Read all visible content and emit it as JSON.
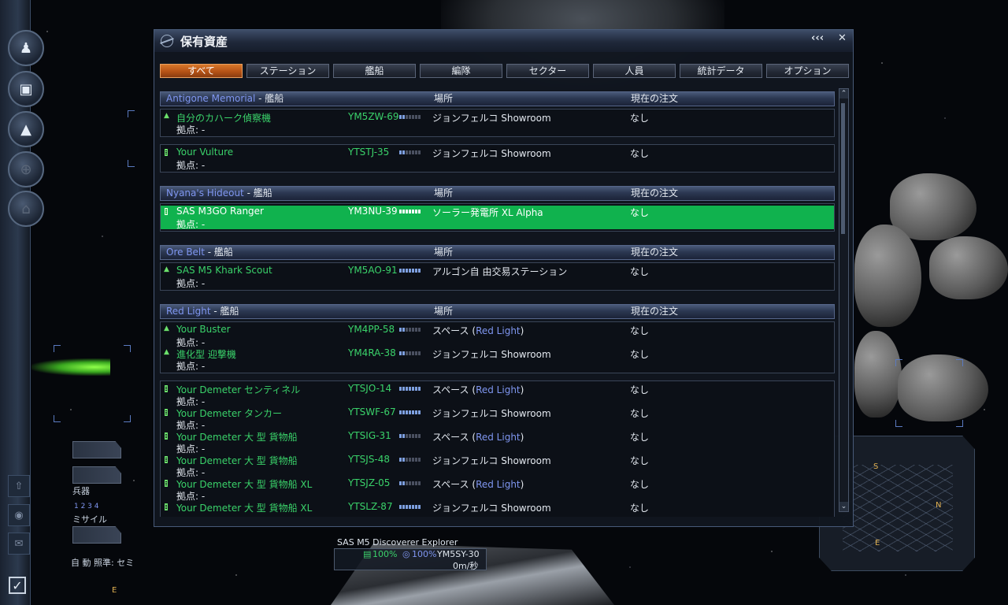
{
  "window": {
    "title": "保有資産",
    "collapse_label": "‹‹‹",
    "close_label": "✕"
  },
  "tabs": [
    {
      "label": "すべて",
      "active": true
    },
    {
      "label": "ステーション"
    },
    {
      "label": "艦船"
    },
    {
      "label": "編隊"
    },
    {
      "label": "セクター"
    },
    {
      "label": "人員"
    },
    {
      "label": "統計データ"
    },
    {
      "label": "オプション"
    }
  ],
  "columns": {
    "location": "場所",
    "order": "現在の注文"
  },
  "groups": [
    {
      "sector": "Antigone Memorial",
      "suffix": " - 艦船"
    },
    {
      "sector": "Nyana's Hideout",
      "suffix": " - 艦船"
    },
    {
      "sector": "Ore Belt",
      "suffix": " - 艦船"
    },
    {
      "sector": "Red Light",
      "suffix": " - 艦船"
    }
  ],
  "ships": [
    {
      "name": "自分のカハーク偵察機",
      "home": "拠点: -",
      "id": "YM5ZW-69",
      "location": "ジョンフェルコ Showroom",
      "order": "なし"
    },
    {
      "name": "Your Vulture",
      "home": "拠点: -",
      "id": "YTSTJ-35",
      "location": "ジョンフェルコ Showroom",
      "order": "なし"
    },
    {
      "name": "SAS M3GO Ranger",
      "home": "拠点: -",
      "id": "YM3NU-39",
      "location": "ソーラー発電所 XL Alpha",
      "order": "なし"
    },
    {
      "name": "SAS M5 Khark Scout",
      "home": "拠点: -",
      "id": "YM5AO-91",
      "location": "アルゴン自 由交易ステーション",
      "order": "なし"
    },
    {
      "name": "Your Buster",
      "home": "拠点: -",
      "id": "YM4PP-58",
      "location_prefix": "スペース (",
      "location_sector": "Red Light",
      "location_suffix": ")",
      "order": "なし"
    },
    {
      "name": "進化型 迎撃機",
      "home": "拠点: -",
      "id": "YM4RA-38",
      "location": "ジョンフェルコ Showroom",
      "order": "なし"
    },
    {
      "name": "Your Demeter センティネル",
      "home": "拠点: -",
      "id": "YTSJO-14",
      "location_prefix": "スペース (",
      "location_sector": "Red Light",
      "location_suffix": ")",
      "order": "なし"
    },
    {
      "name": "Your Demeter タンカー",
      "home": "拠点: -",
      "id": "YTSWF-67",
      "location": "ジョンフェルコ Showroom",
      "order": "なし"
    },
    {
      "name": "Your Demeter 大 型 貨物船",
      "home": "拠点: -",
      "id": "YTSIG-31",
      "location_prefix": "スペース (",
      "location_sector": "Red Light",
      "location_suffix": ")",
      "order": "なし"
    },
    {
      "name": "Your Demeter 大 型 貨物船",
      "home": "拠点: -",
      "id": "YTSJS-48",
      "location": "ジョンフェルコ Showroom",
      "order": "なし"
    },
    {
      "name": "Your Demeter 大 型 貨物船 XL",
      "home": "拠点: -",
      "id": "YTSJZ-05",
      "location_prefix": "スペース (",
      "location_sector": "Red Light",
      "location_suffix": ")",
      "order": "なし"
    },
    {
      "name": "Your Demeter 大 型 貨物船 XL",
      "home": "拠点: -",
      "id": "YTSLZ-87",
      "location": "ジョンフェルコ Showroom",
      "order": "なし"
    }
  ],
  "hud": {
    "weapons_label": "兵器",
    "weapon_groups": "1 2 3 4",
    "missile_label": "ミサイル",
    "auto_aim": "自 動 照準: セミ",
    "compass_e_left": "E",
    "radar": {
      "s": "S",
      "n": "N",
      "e": "E"
    }
  },
  "status": {
    "ship_name": "SAS M5 Discoverer Explorer",
    "hull": "100%",
    "shield": "100%",
    "ship_id": "YM5SY-30",
    "speed": "0m/秒"
  }
}
